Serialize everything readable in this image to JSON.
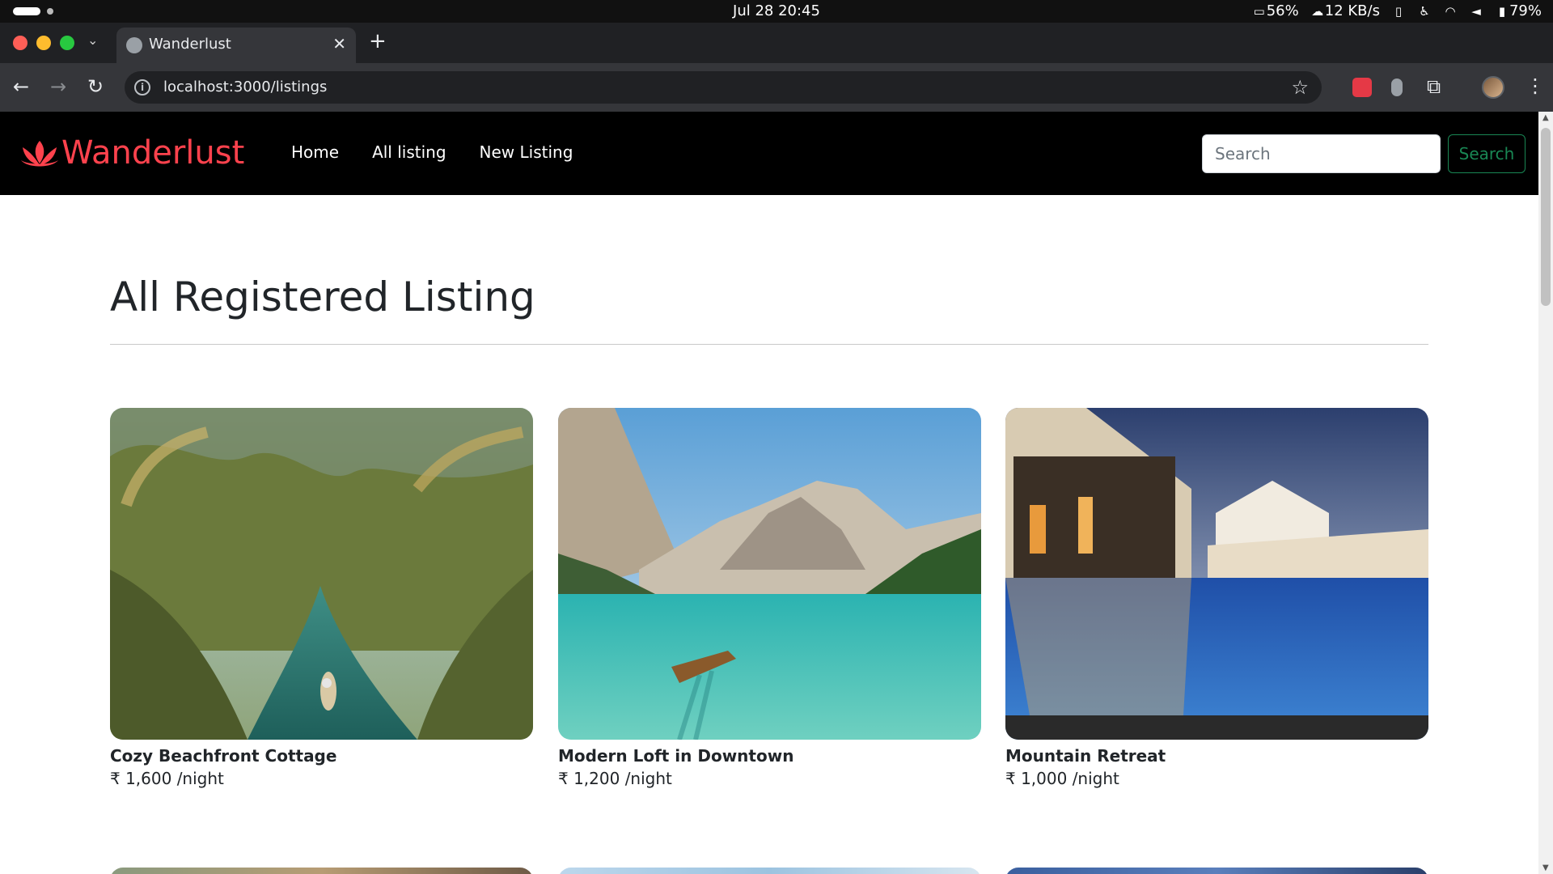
{
  "os": {
    "clock": "Jul 28  20:45",
    "cpu": "56%",
    "net": "12 KB/s",
    "battery": "79%"
  },
  "browser": {
    "tab_title": "Wanderlust",
    "url": "localhost:3000/listings"
  },
  "site": {
    "brand": "Wanderlust",
    "brand_color": "#fe424d",
    "nav": [
      "Home",
      "All listing",
      "New Listing"
    ],
    "search_placeholder": "Search",
    "search_button": "Search"
  },
  "page": {
    "title": "All Registered Listing",
    "listings": [
      {
        "title": "Cozy Beachfront Cottage",
        "price": "₹ 1,600 /night",
        "image": "tropical-river-palms"
      },
      {
        "title": "Modern Loft in Downtown",
        "price": "₹ 1,200 /night",
        "image": "alpine-lake-boat"
      },
      {
        "title": "Mountain Retreat",
        "price": "₹ 1,000 /night",
        "image": "resort-pool-night"
      }
    ]
  }
}
